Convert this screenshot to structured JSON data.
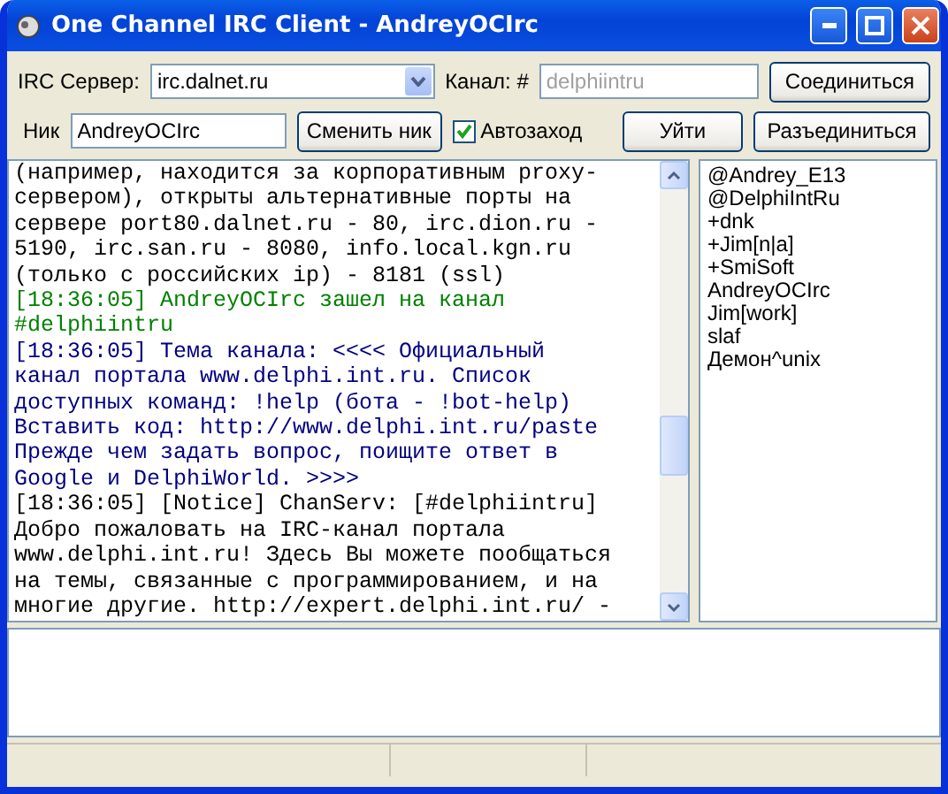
{
  "window": {
    "title": "One Channel IRC Client - AndreyOCIrc"
  },
  "toolbar": {
    "server_label": "IRC Сервер:",
    "server_value": "irc.dalnet.ru",
    "channel_label": "Канал: #",
    "channel_placeholder": "delphiintru",
    "connect_button": "Соединиться",
    "nick_label": "Ник",
    "nick_value": "AndreyOCIrc",
    "change_nick_button": "Сменить ник",
    "autojoin": {
      "label": "Автозаход",
      "checked": true
    },
    "leave_button": "Уйти",
    "disconnect_button": "Разъединиться"
  },
  "chat": {
    "messages": [
      {
        "kind": "system",
        "lines": [
          "(например, находится за корпоративным proxy-",
          "сервером), открыты альтернативные порты на",
          "сервере port80.dalnet.ru - 80, irc.dion.ru -",
          "5190, irc.san.ru - 8080, info.local.kgn.ru",
          "(только с российских ip) - 8181 (ssl)"
        ]
      },
      {
        "kind": "join",
        "lines": [
          "[18:36:05] AndreyOCIrc зашел на канал",
          "#delphiintru"
        ]
      },
      {
        "kind": "topic",
        "lines": [
          "[18:36:05] Тема канала: <<<< Официальный",
          "канал портала www.delphi.int.ru. Список",
          "доступных команд: !help (бота - !bot-help)",
          "Вставить код: http://www.delphi.int.ru/paste",
          "Прежде чем задать вопрос, поищите ответ в",
          "Google и DelphiWorld. >>>>"
        ]
      },
      {
        "kind": "notice",
        "lines": [
          "[18:36:05] [Notice] ChanServ: [#delphiintru]",
          "Добро пожаловать на IRC-канал портала",
          "www.delphi.int.ru! Здесь Вы можете пообщаться",
          "на темы, связанные с программированием, и на",
          "многие другие. http://expert.delphi.int.ru/ -"
        ]
      }
    ]
  },
  "users": [
    "@Andrey_E13",
    "@DelphiIntRu",
    "+dnk",
    "+Jim[n|a]",
    "+SmiSoft",
    "AndreyOCIrc",
    "Jim[work]",
    "slaf",
    "Демон^unix"
  ]
}
